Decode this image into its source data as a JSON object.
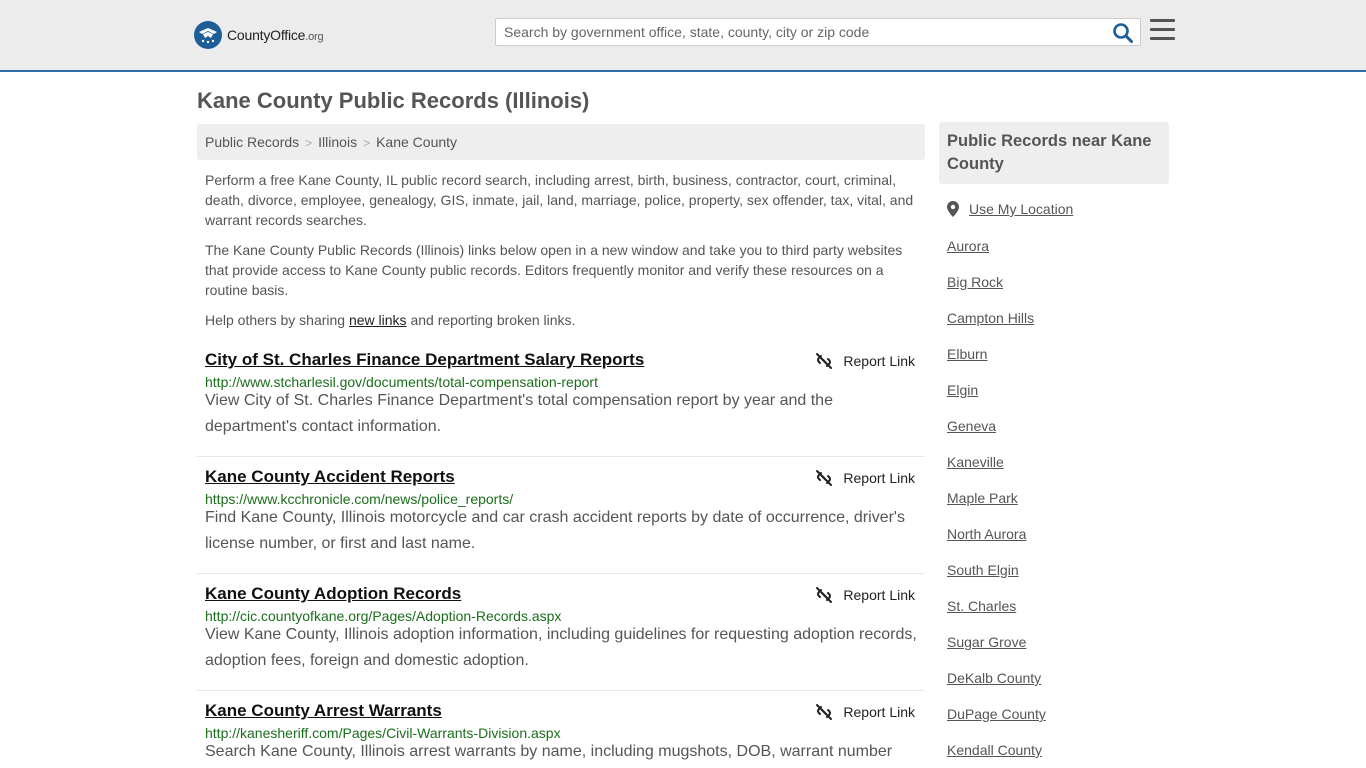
{
  "header": {
    "logo_main": "CountyOffice",
    "logo_tld": ".org",
    "search_placeholder": "Search by government office, state, county, city or zip code"
  },
  "page_title": "Kane County Public Records (Illinois)",
  "breadcrumb": [
    "Public Records",
    "Illinois",
    "Kane County"
  ],
  "intro": {
    "para1": "Perform a free Kane County, IL public record search, including arrest, birth, business, contractor, court, criminal, death, divorce, employee, genealogy, GIS, inmate, jail, land, marriage, police, property, sex offender, tax, vital, and warrant records searches.",
    "para2": "The Kane County Public Records (Illinois) links below open in a new window and take you to third party websites that provide access to Kane County public records. Editors frequently monitor and verify these resources on a routine basis.",
    "help_before": "Help others by sharing ",
    "help_link": "new links",
    "help_after": " and reporting broken links."
  },
  "report_label": "Report Link",
  "records": [
    {
      "title": "City of St. Charles Finance Department Salary Reports",
      "url": "http://www.stcharlesil.gov/documents/total-compensation-report",
      "desc": "View City of St. Charles Finance Department's total compensation report by year and the department's contact information."
    },
    {
      "title": "Kane County Accident Reports",
      "url": "https://www.kcchronicle.com/news/police_reports/",
      "desc": "Find Kane County, Illinois motorcycle and car crash accident reports by date of occurrence, driver's license number, or first and last name."
    },
    {
      "title": "Kane County Adoption Records",
      "url": "http://cic.countyofkane.org/Pages/Adoption-Records.aspx",
      "desc": "View Kane County, Illinois adoption information, including guidelines for requesting adoption records, adoption fees, foreign and domestic adoption."
    },
    {
      "title": "Kane County Arrest Warrants",
      "url": "http://kanesheriff.com/Pages/Civil-Warrants-Division.aspx",
      "desc": "Search Kane County, Illinois arrest warrants by name, including mugshots, DOB, warrant number"
    }
  ],
  "sidebar": {
    "heading": "Public Records near Kane County",
    "use_location": "Use My Location",
    "links": [
      "Aurora",
      "Big Rock",
      "Campton Hills",
      "Elburn",
      "Elgin",
      "Geneva",
      "Kaneville",
      "Maple Park",
      "North Aurora",
      "South Elgin",
      "St. Charles",
      "Sugar Grove",
      "DeKalb County",
      "DuPage County",
      "Kendall County"
    ]
  },
  "colors": {
    "accent": "#2d6ea6",
    "url_green": "#1b6e1b",
    "header_bg": "#ececec"
  }
}
